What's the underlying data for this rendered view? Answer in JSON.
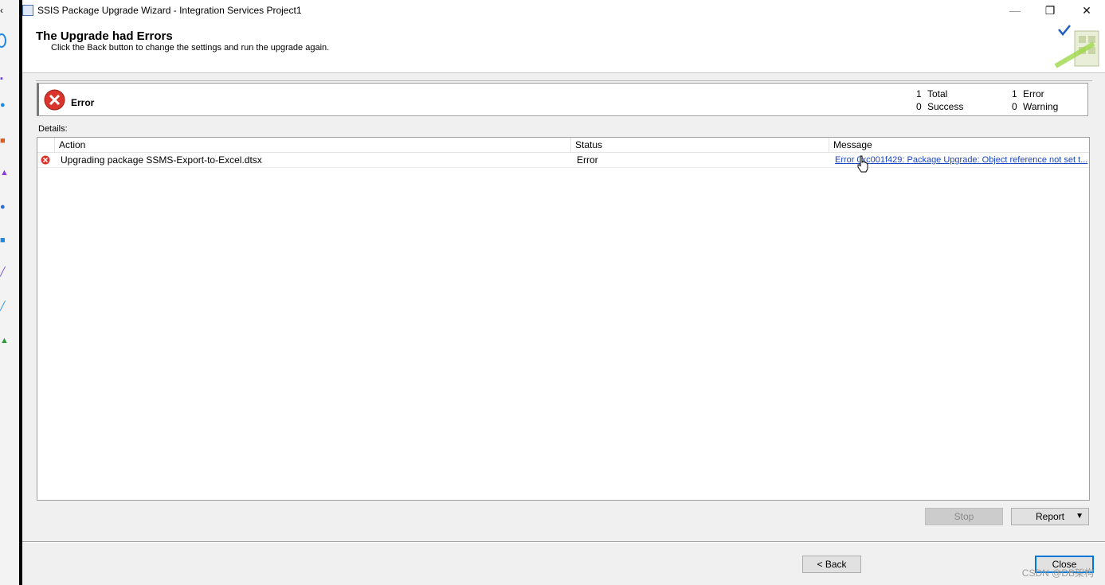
{
  "window": {
    "title": "SSIS Package Upgrade Wizard - Integration Services Project1",
    "minimize_icon": "minimize-icon",
    "maximize_icon": "restore-icon",
    "close_icon": "close-icon"
  },
  "header": {
    "title": "The Upgrade had Errors",
    "subtitle": "Click the Back button to change the settings and run the upgrade again."
  },
  "summary": {
    "status": "Error",
    "total_count": "1",
    "total_label": "Total",
    "success_count": "0",
    "success_label": "Success",
    "error_count": "1",
    "error_label": "Error",
    "warning_count": "0",
    "warning_label": "Warning"
  },
  "details": {
    "label": "Details:",
    "columns": [
      "Action",
      "Status",
      "Message"
    ],
    "rows": [
      {
        "action": "Upgrading package SSMS-Export-to-Excel.dtsx",
        "status": "Error",
        "message": "Error 0xc001f429: Package Upgrade: Object reference not set t..."
      }
    ]
  },
  "buttons": {
    "stop": "Stop",
    "report": "Report",
    "back": "< Back",
    "close": "Close"
  },
  "watermark": "CSDN @DB架构",
  "colors": {
    "error_red": "#d9352c",
    "link_blue": "#1a44c2",
    "default_button_border": "#0078d7"
  }
}
